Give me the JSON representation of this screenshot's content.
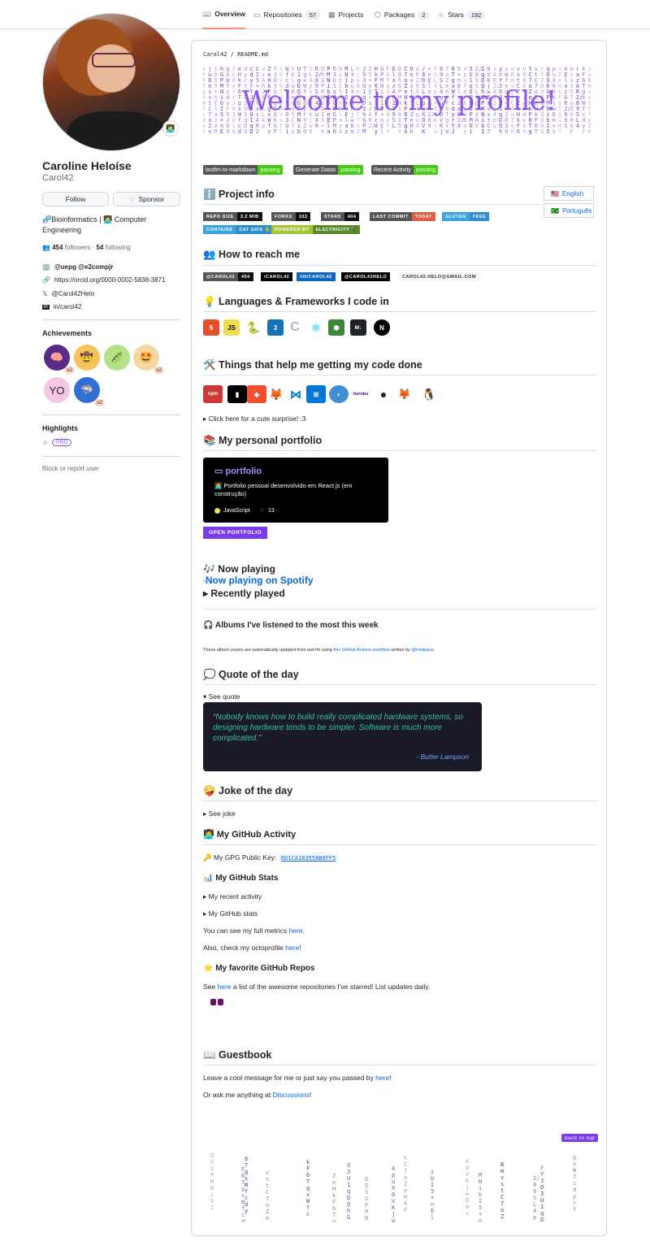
{
  "tabs": [
    {
      "label": "Overview"
    },
    {
      "label": "Repositories",
      "count": "57"
    },
    {
      "label": "Projects"
    },
    {
      "label": "Packages",
      "count": "2"
    },
    {
      "label": "Stars",
      "count": "192"
    }
  ],
  "profile": {
    "name": "Caroline Heloíse",
    "login": "Carol42",
    "follow": "Follow",
    "sponsor": "Sponsor",
    "bio": "🧬Bioinformatics | 👩‍💻 Computer Engineering",
    "followers": "454",
    "followers_label": "followers",
    "following": "54",
    "following_label": "following",
    "org": "@uepg @e2compjr",
    "orcid": "https://orcid.org/0000-0002-5838-3871",
    "twitter": "@Carol42Helo",
    "linkedin": "in/carol42",
    "achievements_title": "Achievements",
    "x2": "x2",
    "highlights_title": "Highlights",
    "pro": "PRO",
    "block": "Block or report user"
  },
  "readme": {
    "path": "Carol42",
    "file": "README.md",
    "welcome": "Welcome to my profile!",
    "badges": [
      {
        "l": "lastfm-to-markdown",
        "r": "passing"
      },
      {
        "l": "Generate Datas",
        "r": "passing"
      },
      {
        "l": "Recent Activity",
        "r": "passing"
      }
    ],
    "lang_en": "English",
    "lang_pt": "Português",
    "project_info": "ℹ️ Project info",
    "proj_badges": [
      {
        "l": "REPO SIZE",
        "r": "3.2 MIB"
      },
      {
        "l": "FORKS",
        "r": "102"
      },
      {
        "l": "STARS",
        "r": "404"
      },
      {
        "l": "LAST COMMIT",
        "r": "TODAY"
      },
      {
        "l": "GLUTEN",
        "r": "FREE"
      },
      {
        "l": "CONTAINS",
        "r": "CAT GIFS 🐈"
      },
      {
        "l": "POWERED BY",
        "r": "ELECTRICITY 🔌"
      }
    ],
    "reach": "👥 How to reach me",
    "reach_badges": [
      {
        "l": "@CAROL42",
        "r": "454"
      },
      {
        "l": "",
        "r": "/CAROL42"
      },
      {
        "l": "",
        "r": "/IN/CAROL42"
      },
      {
        "l": "",
        "r": "@CAROL42HELO"
      },
      {
        "l": "",
        "r": "CAROL42.HELO@GMAIL.COM"
      }
    ],
    "langs": "💡 Languages & Frameworks I code in",
    "tools": "🛠️ Things that help me getting my code done",
    "surprise": "Click here for a cute surprise! :3",
    "portfolio": "📚 My personal portfolio",
    "port_name": "portfolio",
    "port_desc": "👩‍💻 Portfolio pessoal desenvolvido em React.js (em construção)",
    "port_lang": "JavaScript",
    "port_stars": "13",
    "open_portfolio": "OPEN PORTFOLIO",
    "now_playing": "🎶 Now playing",
    "spotify": "Now playing on Spotify",
    "recently": "Recently played",
    "albums": "🎧 Albums I've listened to the most this week",
    "albums_note_a": "These album covers are automatically updated from last.fm using",
    "albums_link": "this GitHub Actions workflow",
    "albums_note_b": "written by",
    "albums_author": "@melipass",
    "quote_title": "💭 Quote of the day",
    "see_quote": "See quote",
    "quote": "Nobody knows how to build really complicated hardware systems, so designing hardware tends to be simpler. Software is much more complicated.",
    "quote_author": "- Butler Lampson",
    "joke_title": "🤪 Joke of the day",
    "see_joke": "See joke",
    "activity_title": "👩‍💻 My GitHub Activity",
    "gpg_label": "🔑 My GPG Public Key:",
    "gpg": "6D1CA183558B0FF5",
    "stats_title": "📊 My GitHub Stats",
    "recent_activity": "My recent activity",
    "gh_stats": "My GitHub stats",
    "metrics_a": "You can see my full metrics",
    "here": "here",
    "octo_a": "Also, check my octoprofile",
    "fav_title": "⭐ My favorite GitHub Repos",
    "fav_a": "See",
    "fav_b": "a list of the awesome repositories I've starred! List updates daily.",
    "guest_title": "📖 Guestbook",
    "guest_a": "Leave a cool message for me or just say you passed by",
    "guest_b": "Or ask me anything at",
    "discussions": "Discussions",
    "back_top": "back to top"
  },
  "colors": {
    "accent": "#7c3aed",
    "orange": "#fd8c73",
    "link": "#0969da"
  }
}
